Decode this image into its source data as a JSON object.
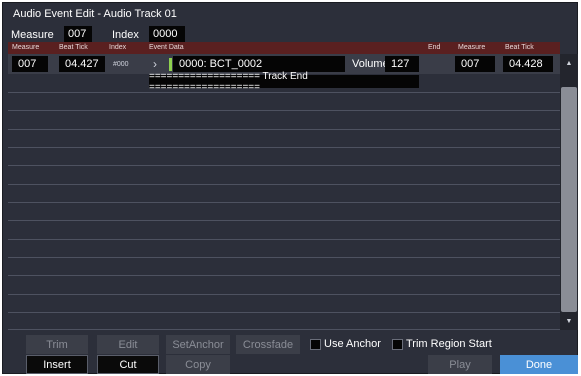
{
  "window": {
    "title": "Audio Event Edit - Audio Track 01"
  },
  "header": {
    "measure_label": "Measure",
    "measure_value": "007",
    "index_label": "Index",
    "index_value": "0000"
  },
  "columns": {
    "measure": "Measure",
    "beat_tick": "Beat Tick",
    "index": "Index",
    "event_data": "Event Data",
    "end": "End",
    "end_measure": "Measure",
    "end_beat_tick": "Beat Tick"
  },
  "row": {
    "measure": "007",
    "beat_tick": "04.427",
    "index": "#000",
    "event": "0000: BCT_0002",
    "volume_label": "Volume",
    "volume_value": "127",
    "end_measure": "007",
    "end_beat_tick": "04.428"
  },
  "track_end": "=================== Track End ===================",
  "scrollbar": {
    "up_icon": "▲",
    "down_icon": "▼"
  },
  "chevron_icon": "›",
  "buttons_row1": {
    "trim": "Trim",
    "edit": "Edit",
    "set_anchor": "SetAnchor",
    "crossfade": "Crossfade",
    "use_anchor": "Use Anchor",
    "trim_region_start": "Trim Region Start"
  },
  "buttons_row2": {
    "insert": "Insert",
    "cut": "Cut",
    "copy": "Copy",
    "play": "Play",
    "done": "Done"
  },
  "colors": {
    "background": "#2c2f3a",
    "column_header": "#5a2020",
    "done_button": "#4a90d6",
    "marker": "#8fd14f"
  }
}
